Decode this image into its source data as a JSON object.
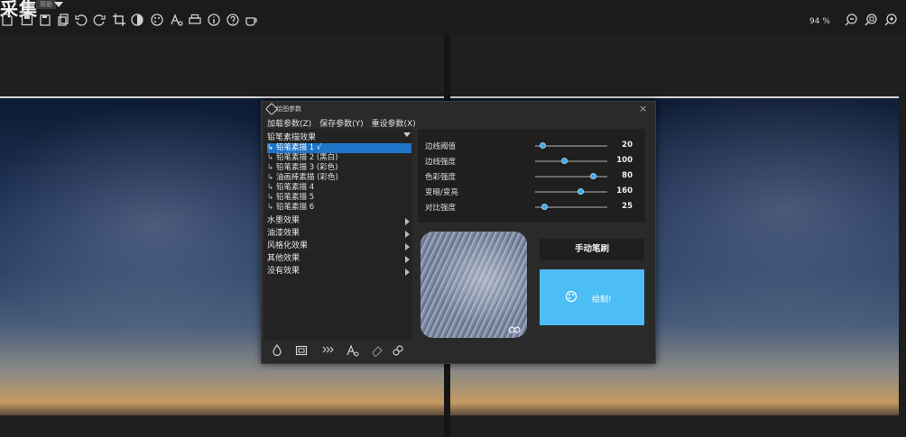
{
  "app": {
    "title": "采集",
    "help_menu": "帮助"
  },
  "toolbar": {
    "zoom_label": "94 %",
    "icons": [
      "new-icon",
      "save-icon",
      "save-as-icon",
      "copy-icon",
      "rotate-left-icon",
      "rotate-right-icon",
      "crop-icon",
      "contrast-icon",
      "palette-icon",
      "text-style-icon",
      "print-icon",
      "info-icon",
      "help-icon",
      "coffee-icon",
      "zoom-out-icon",
      "zoom-fit-icon",
      "zoom-in-icon"
    ]
  },
  "dialog": {
    "title": "绘图参数",
    "menu": {
      "load": "加载参数(Z)",
      "save": "保存参数(Y)",
      "reset": "重设参数(X)"
    },
    "category_header": "铅笔素描效果",
    "sub_items": [
      {
        "label": "铅笔素描 1 √",
        "selected": true
      },
      {
        "label": "铅笔素描 2 (黑白)",
        "selected": false
      },
      {
        "label": "铅笔素描 3 (彩色)",
        "selected": false
      },
      {
        "label": "油画棒素描 (彩色)",
        "selected": false
      },
      {
        "label": "铅笔素描 4",
        "selected": false
      },
      {
        "label": "铅笔素描 5",
        "selected": false
      },
      {
        "label": "铅笔素描 6",
        "selected": false
      }
    ],
    "categories": [
      "水墨效果",
      "油漆效果",
      "风格化效果",
      "其他效果",
      "没有效果"
    ],
    "params": [
      {
        "label": "边线阈值",
        "value": "20",
        "level": 0.1
      },
      {
        "label": "边线强度",
        "value": "100",
        "level": 0.4
      },
      {
        "label": "色彩强度",
        "value": "80",
        "level": 0.8
      },
      {
        "label": "变暗/变亮",
        "value": "160",
        "level": 0.63
      },
      {
        "label": "对比强度",
        "value": "25",
        "level": 0.12
      }
    ],
    "manual_button": "手动笔刷",
    "draw_button": "绘制!"
  }
}
